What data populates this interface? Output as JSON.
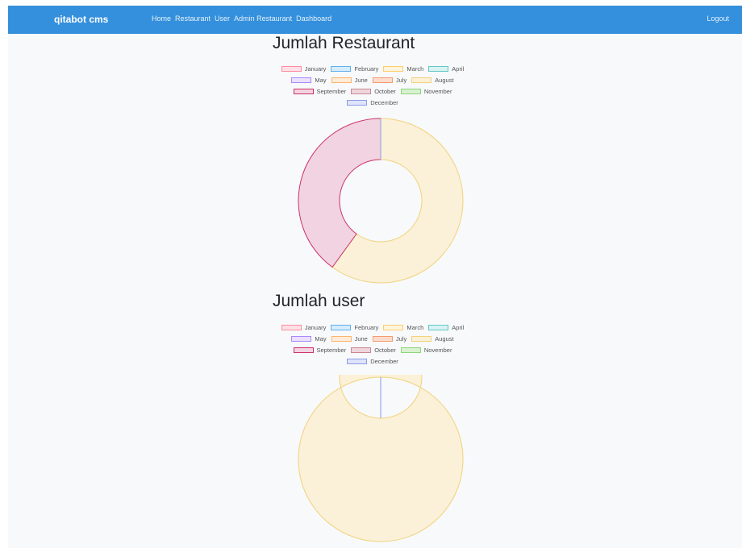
{
  "navbar": {
    "brand": "qitabot cms",
    "links": [
      "Home",
      "Restaurant",
      "User",
      "Admin Restaurant",
      "Dashboard"
    ],
    "logout": "Logout",
    "color": "#3490dc"
  },
  "months": [
    "January",
    "February",
    "March",
    "April",
    "May",
    "June",
    "July",
    "August",
    "September",
    "October",
    "November",
    "December"
  ],
  "month_colors": [
    {
      "fill": "#ffe0e6",
      "border": "#ff8aa1"
    },
    {
      "fill": "#d7ecfb",
      "border": "#5eb0ef"
    },
    {
      "fill": "#fff4dd",
      "border": "#ffce6b"
    },
    {
      "fill": "#dbf2f2",
      "border": "#63c7c7"
    },
    {
      "fill": "#ebe0ff",
      "border": "#a988ff"
    },
    {
      "fill": "#ffecd9",
      "border": "#ffb36b"
    },
    {
      "fill": "#ffdccc",
      "border": "#f59a74"
    },
    {
      "fill": "#fbf1d8",
      "border": "#f2d27a"
    },
    {
      "fill": "#f2d3e1",
      "border": "#cc3366"
    },
    {
      "fill": "#efd6dc",
      "border": "#c98893"
    },
    {
      "fill": "#d8f2d0",
      "border": "#8fd47a"
    },
    {
      "fill": "#dfe4fb",
      "border": "#8a9ce6"
    }
  ],
  "sections": [
    {
      "title": "Jumlah Restaurant"
    },
    {
      "title": "Jumlah user"
    }
  ],
  "chart_data": [
    {
      "type": "pie",
      "subtype": "doughnut",
      "title": "Jumlah Restaurant",
      "categories": [
        "January",
        "February",
        "March",
        "April",
        "May",
        "June",
        "July",
        "August",
        "September",
        "October",
        "November",
        "December"
      ],
      "values": [
        0,
        0,
        0,
        0,
        0,
        0,
        0,
        3,
        2,
        0,
        0,
        0
      ],
      "legend": "top"
    },
    {
      "type": "pie",
      "subtype": "doughnut",
      "title": "Jumlah user",
      "categories": [
        "January",
        "February",
        "March",
        "April",
        "May",
        "June",
        "July",
        "August",
        "September",
        "October",
        "November",
        "December"
      ],
      "values": [
        0,
        0,
        0,
        0,
        0,
        0,
        0,
        1,
        0,
        0,
        0,
        0
      ],
      "legend": "top"
    }
  ]
}
